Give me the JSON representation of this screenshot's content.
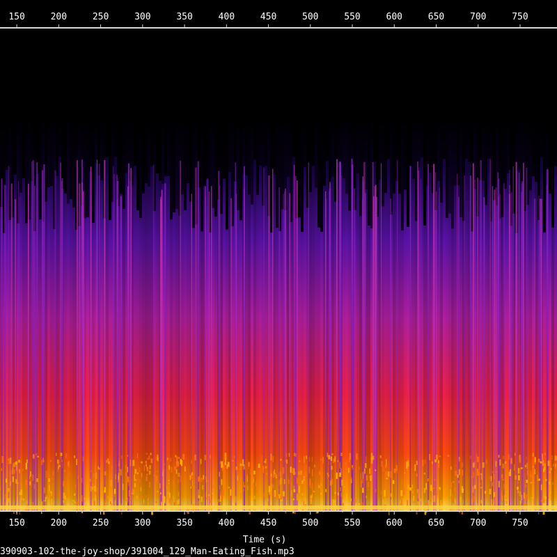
{
  "chart_data": {
    "type": "heatmap",
    "subtype": "spectrogram",
    "xlabel": "Time (s)",
    "x_ticks": [
      150,
      200,
      250,
      300,
      350,
      400,
      450,
      500,
      550,
      600,
      650,
      700,
      750
    ],
    "xlim": [
      130,
      794
    ],
    "colormap": [
      "#000000",
      "#1a0550",
      "#5a12a8",
      "#b01fa0",
      "#f0204a",
      "#ff4a10",
      "#ffa000",
      "#ffe060"
    ],
    "file_label": "390903-102-the-joy-shop/391004_129_Man-Eating_Fish.mp3"
  }
}
